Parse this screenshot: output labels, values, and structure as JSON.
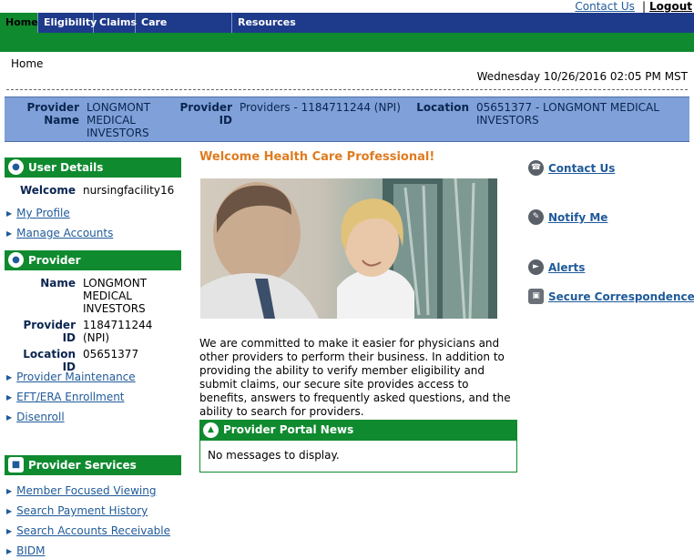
{
  "top_links": {
    "contact": "Contact Us",
    "separator": "|",
    "logout": "Logout"
  },
  "nav": [
    {
      "label": "Home",
      "active": true
    },
    {
      "label": "Eligibility"
    },
    {
      "label": "Claims"
    },
    {
      "label": "Care Management"
    },
    {
      "label": "Resources"
    }
  ],
  "breadcrumb": "Home",
  "datetime": "Wednesday 10/26/2016 02:05 PM MST",
  "provider_band": {
    "provider_label": "Provider Name",
    "provider_value": "LONGMONT MEDICAL INVESTORS",
    "id_label": "Provider ID",
    "id_value": "Providers - 1184711244 (NPI)",
    "location_label": "Location",
    "location_value": "05651377 - LONGMONT MEDICAL INVESTORS"
  },
  "user_details": {
    "title": "User Details",
    "welcome_label": "Welcome",
    "welcome_value": "nursingfacility16",
    "links": [
      "My Profile",
      "Manage Accounts"
    ]
  },
  "provider": {
    "title": "Provider",
    "name_label": "Name",
    "name_value": "LONGMONT MEDICAL INVESTORS",
    "id_label": "Provider ID",
    "id_value": "1184711244 (NPI)",
    "location_label": "Location ID",
    "location_value": "05651377",
    "links": [
      "Provider Maintenance",
      "EFT/ERA Enrollment",
      "Disenroll"
    ]
  },
  "provider_services": {
    "title": "Provider Services",
    "links": [
      "Member Focused Viewing",
      "Search Payment History",
      "Search Accounts Receivable",
      "BIDM"
    ]
  },
  "main": {
    "welcome": "Welcome Health Care Professional!",
    "intro": "We are committed to make it easier for physicians and other providers to perform their business. In addition to providing the ability to verify member eligibility and submit claims, our secure site provides access to benefits, answers to frequently asked questions, and the ability to search for providers.",
    "news_title": "Provider Portal News",
    "news_body": "No messages to display."
  },
  "quick_links": [
    "Contact Us",
    "Notify Me",
    "Alerts",
    "Secure Correspondence"
  ],
  "colors": {
    "nav_blue": "#1e3a8a",
    "green": "#0f8a2f",
    "band_blue": "#7fa0d8",
    "orange": "#e07b1f"
  }
}
